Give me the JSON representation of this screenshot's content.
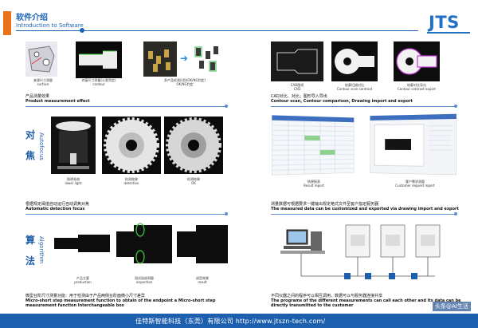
{
  "header": {
    "title_cn": "软件介绍",
    "title_en": "Introduction to Software",
    "logo": "JTS"
  },
  "left": {
    "row1_captions": [
      [
        "来源尺寸测量",
        "surface"
      ],
      [
        "对接尺寸测量(公差判定)",
        "contour"
      ],
      [
        "多产品检测识别(OK/NG判定)",
        "OK/NG判定"
      ]
    ],
    "row1_title_cn": "产品测量效果",
    "row1_title_en": "Product measurement effect",
    "section2_label_cn": [
      "对",
      "焦"
    ],
    "section2_label_en": "Autofocus",
    "row2_captions": [
      [
        "照明系统",
        "lower light"
      ],
      [
        "检测效果",
        "detection"
      ],
      [
        "检测结果",
        "OK"
      ]
    ],
    "row2_title_cn": "根据规定阈值自动运行自动调焦对焦",
    "row2_title_en": "Automatic detection focus",
    "section3_label_cn": [
      "算",
      "法"
    ],
    "section3_label_en": "Algorithm",
    "row3_captions": [
      [
        "产品主要",
        "production"
      ],
      [
        "测试局部测量",
        "inspection"
      ],
      [
        "成型效果",
        "result"
      ]
    ],
    "row3_title_cn": "微型台阶尺寸测量功能：用于检测由于产品两侧台阶面微小尺寸差异",
    "row3_title_en": "Micro-short step measurement function to obtain of the endpoint a Micro-short step measurement function Interchangeable box"
  },
  "right": {
    "row1_captions": [
      [
        "CAD图纸",
        "CAD"
      ],
      [
        "轮廓扫描对比",
        "Contour scan contrast"
      ],
      [
        "轮廓对比导出",
        "Contour contrast export"
      ]
    ],
    "row1_title_cn": "CAD对比、对比；图形导入导出",
    "row1_title_en": "Contour scan, Contour comparison, Drawing import and export",
    "row2_captions": [
      [
        "结果报表",
        "Result report"
      ],
      [
        "客户需求测量",
        "Customer request report"
      ]
    ],
    "row2_title_cn": "测量数据可根据要求一键输出规定格式文件至客户指定服务器",
    "row2_title_en": "The measured data can be customized and exported via drawing import and export",
    "row3_title_cn": "不同仪器之间的程序可以相互调用，数据可以与服务器连接共享",
    "row3_title_en": "The programs of the different measurements can call each other and its data can be directly transmitted to the customer"
  },
  "footer": {
    "text": "佳特斯智能科技（东莞）有限公司    http://www.jtszn-tech.com/",
    "watermark": "头条@AI生活"
  },
  "colors": {
    "accent": "#e8731a",
    "brand": "#1c63b7",
    "footer": "#1c5fae"
  }
}
